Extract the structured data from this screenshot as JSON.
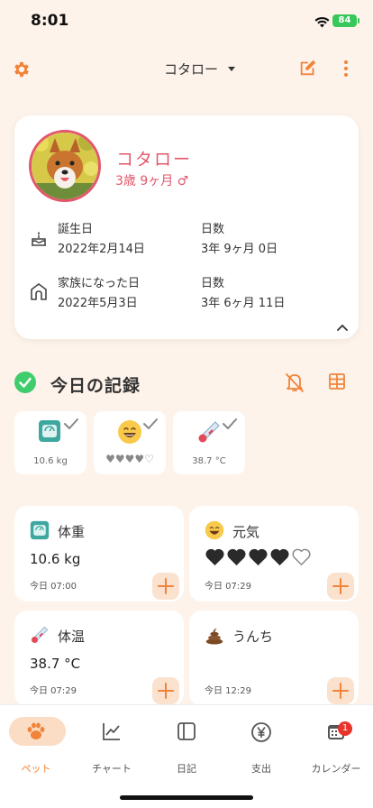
{
  "status_bar": {
    "time": "8:01",
    "battery": "84"
  },
  "header": {
    "pet_selector": "コタロー"
  },
  "profile": {
    "name": "コタロー",
    "age": "3歳 9ヶ月 ♂",
    "birthday_label": "誕生日",
    "birthday_value": "2022年2月14日",
    "birthday_days_label": "日数",
    "birthday_days_value": "3年 9ヶ月 0日",
    "family_label": "家族になった日",
    "family_value": "2022年5月3日",
    "family_days_label": "日数",
    "family_days_value": "3年 6ヶ月 11日"
  },
  "today": {
    "title": "今日の記録",
    "mini": [
      {
        "value": "10.6 kg",
        "icon": "scale-icon"
      },
      {
        "value": "♥♥♥♥♡",
        "icon": "happy-face-icon"
      },
      {
        "value": "38.7 °C",
        "icon": "thermometer-icon"
      }
    ]
  },
  "records": [
    {
      "title": "体重",
      "value": "10.6 kg",
      "time": "今日 07:00",
      "icon": "scale-icon"
    },
    {
      "title": "元気",
      "value": "",
      "hearts_filled": 4,
      "hearts_total": 5,
      "time": "今日 07:29",
      "icon": "happy-face-icon"
    },
    {
      "title": "体温",
      "value": "38.7 °C",
      "time": "今日 07:29",
      "icon": "thermometer-icon"
    },
    {
      "title": "うんち",
      "value": "",
      "time": "今日 12:29",
      "icon": "poop-icon"
    }
  ],
  "tabs": [
    {
      "label": "ペット",
      "icon": "paw-icon"
    },
    {
      "label": "チャート",
      "icon": "chart-icon"
    },
    {
      "label": "日記",
      "icon": "notebook-icon"
    },
    {
      "label": "支出",
      "icon": "yen-icon"
    },
    {
      "label": "カレンダー",
      "icon": "calendar-icon",
      "badge": "1"
    }
  ],
  "colors": {
    "accent": "#f0843a",
    "pet_pink": "#e2576b",
    "background": "#fdf3ea",
    "check_green": "#3fcc6b"
  }
}
